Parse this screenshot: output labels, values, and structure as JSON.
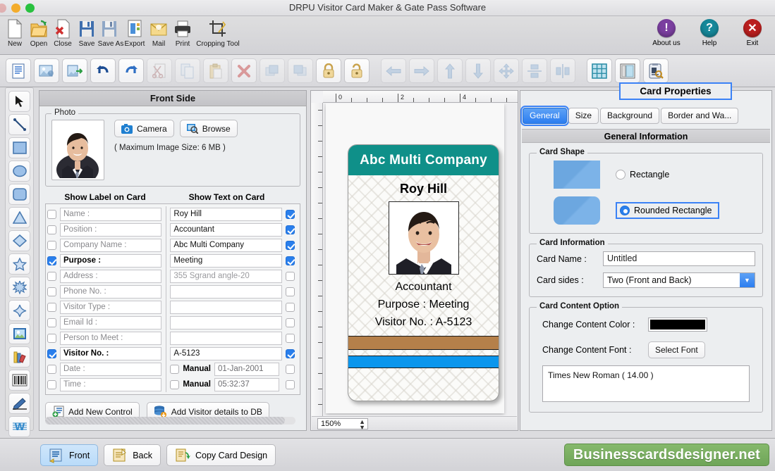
{
  "window": {
    "title": "DRPU Visitor Card Maker & Gate Pass Software",
    "traffic_lights": [
      "close",
      "minimize",
      "maximize"
    ]
  },
  "main_toolbar": {
    "items": [
      {
        "label": "New",
        "icon": "new-document-icon"
      },
      {
        "label": "Open",
        "icon": "open-folder-icon"
      },
      {
        "label": "Close",
        "icon": "close-document-icon"
      },
      {
        "label": "Save",
        "icon": "save-icon"
      },
      {
        "label": "Save As",
        "icon": "save-as-icon"
      },
      {
        "label": "Export",
        "icon": "export-icon"
      },
      {
        "label": "Mail",
        "icon": "mail-icon"
      },
      {
        "label": "Print",
        "icon": "print-icon"
      },
      {
        "label": "Cropping Tool",
        "icon": "crop-icon"
      }
    ],
    "right_items": [
      {
        "label": "About us",
        "icon": "info-icon",
        "glyph": "!",
        "color": "#7b3fa0"
      },
      {
        "label": "Help",
        "icon": "help-icon",
        "glyph": "?",
        "color": "#16889a"
      },
      {
        "label": "Exit",
        "icon": "exit-icon",
        "glyph": "X",
        "color": "#bb1f1f"
      }
    ]
  },
  "secondary_toolbar": {
    "buttons": [
      {
        "icon": "text-document-icon",
        "enabled": true
      },
      {
        "icon": "insert-image-icon",
        "enabled": true
      },
      {
        "icon": "export-image-icon",
        "enabled": true
      },
      {
        "icon": "undo-icon",
        "enabled": true
      },
      {
        "icon": "redo-icon",
        "enabled": true
      },
      {
        "icon": "cut-icon",
        "enabled": false
      },
      {
        "icon": "copy-icon",
        "enabled": false
      },
      {
        "icon": "paste-icon",
        "enabled": false
      },
      {
        "icon": "delete-icon",
        "enabled": false
      },
      {
        "icon": "bring-front-icon",
        "enabled": false
      },
      {
        "icon": "send-back-icon",
        "enabled": false
      },
      {
        "icon": "lock-icon",
        "enabled": true
      },
      {
        "icon": "unlock-icon",
        "enabled": true
      },
      {
        "icon": "align-left-icon",
        "enabled": false
      },
      {
        "icon": "align-right-icon",
        "enabled": false
      },
      {
        "icon": "align-top-icon",
        "enabled": false
      },
      {
        "icon": "align-bottom-icon",
        "enabled": false
      },
      {
        "icon": "center-both-icon",
        "enabled": false
      },
      {
        "icon": "center-vertical-icon",
        "enabled": false
      },
      {
        "icon": "center-horizontal-icon",
        "enabled": false
      },
      {
        "icon": "grid-icon",
        "enabled": true
      },
      {
        "icon": "card-background-icon",
        "enabled": true
      },
      {
        "icon": "card-properties-icon",
        "enabled": true
      }
    ]
  },
  "left_tools": [
    {
      "icon": "pointer-tool-icon"
    },
    {
      "icon": "line-tool-icon"
    },
    {
      "icon": "rectangle-tool-icon"
    },
    {
      "icon": "ellipse-tool-icon"
    },
    {
      "icon": "rounded-rectangle-tool-icon"
    },
    {
      "icon": "triangle-tool-icon"
    },
    {
      "icon": "diamond-tool-icon"
    },
    {
      "icon": "star-tool-icon"
    },
    {
      "icon": "burst-tool-icon"
    },
    {
      "icon": "four-point-star-tool-icon"
    },
    {
      "icon": "image-tool-icon"
    },
    {
      "icon": "library-tool-icon"
    },
    {
      "icon": "barcode-tool-icon"
    },
    {
      "icon": "signature-tool-icon"
    },
    {
      "icon": "watermark-tool-icon"
    }
  ],
  "left_panel": {
    "title": "Front Side",
    "photo_group_label": "Photo",
    "camera_button": "Camera",
    "browse_button": "Browse",
    "max_size_note": "( Maximum Image Size: 6 MB )",
    "col_label_header": "Show Label on Card",
    "col_text_header": "Show Text on Card",
    "rows": [
      {
        "label": "Name     :",
        "label_checked": false,
        "text": "Roy Hill",
        "text_muted": false,
        "text_checked": true
      },
      {
        "label": "Position   :",
        "label_checked": false,
        "text": "Accountant",
        "text_muted": false,
        "text_checked": true
      },
      {
        "label": "Company Name :",
        "label_checked": false,
        "text": "Abc Multi Company",
        "text_muted": false,
        "text_checked": true
      },
      {
        "label": "Purpose  :",
        "label_checked": true,
        "text": "Meeting",
        "text_muted": false,
        "text_checked": true
      },
      {
        "label": "Address :",
        "label_checked": false,
        "text": "355 Sgrand angle-20",
        "text_muted": true,
        "text_checked": false
      },
      {
        "label": "Phone No. :",
        "label_checked": false,
        "text": "",
        "text_muted": false,
        "text_checked": false
      },
      {
        "label": "Visitor Type :",
        "label_checked": false,
        "text": "",
        "text_muted": false,
        "text_checked": false
      },
      {
        "label": "Email Id :",
        "label_checked": false,
        "text": "",
        "text_muted": false,
        "text_checked": false
      },
      {
        "label": "Person to Meet :",
        "label_checked": false,
        "text": "",
        "text_muted": false,
        "text_checked": false
      },
      {
        "label": "Visitor No. :",
        "label_checked": true,
        "text": "A-5123",
        "text_muted": false,
        "text_checked": true
      }
    ],
    "date_row": {
      "label": "Date :",
      "label_checked": false,
      "manual_label": "Manual",
      "manual_checked": false,
      "value": "01-Jan-2001",
      "text_checked": false
    },
    "time_row": {
      "label": "Time :",
      "label_checked": false,
      "manual_label": "Manual",
      "manual_checked": false,
      "value": "05:32:37",
      "text_checked": false
    },
    "add_control_button": "Add New Control",
    "add_db_button": "Add Visitor details to DB"
  },
  "canvas": {
    "ruler_labels": [
      "0",
      "2",
      "4"
    ],
    "zoom": "150%"
  },
  "id_card": {
    "company": "Abc Multi Company",
    "name": "Roy Hill",
    "position": "Accountant",
    "purpose_line": "Purpose  :  Meeting",
    "visitor_line": "Visitor No. :  A-5123",
    "header_color": "#0f9089",
    "bar1_color": "#b5804a",
    "bar2_color": "#0b96ed"
  },
  "right_panel": {
    "title": "Card Properties",
    "tabs": [
      {
        "label": "General",
        "selected": true
      },
      {
        "label": "Size",
        "selected": false
      },
      {
        "label": "Background",
        "selected": false
      },
      {
        "label": "Border and Wa...",
        "selected": false
      }
    ],
    "section_title": "General Information",
    "card_shape": {
      "group_label": "Card Shape",
      "options": [
        {
          "label": "Rectangle",
          "selected": false
        },
        {
          "label": "Rounded Rectangle",
          "selected": true
        }
      ]
    },
    "card_information": {
      "group_label": "Card Information",
      "card_name_label": "Card Name :",
      "card_name_value": "Untitled",
      "card_sides_label": "Card sides :",
      "card_sides_value": "Two (Front and Back)"
    },
    "card_content": {
      "group_label": "Card Content Option",
      "color_label": "Change Content Color :",
      "color_value": "#000000",
      "font_label": "Change Content Font :",
      "font_button": "Select Font",
      "font_value": "Times New Roman ( 14.00 )"
    }
  },
  "bottom_bar": {
    "buttons": [
      {
        "label": "Front",
        "selected": true,
        "icon": "front-side-icon"
      },
      {
        "label": "Back",
        "selected": false,
        "icon": "back-side-icon"
      },
      {
        "label": "Copy Card Design",
        "selected": false,
        "icon": "copy-design-icon"
      }
    ],
    "brand": "Businesscardsdesigner.net"
  }
}
